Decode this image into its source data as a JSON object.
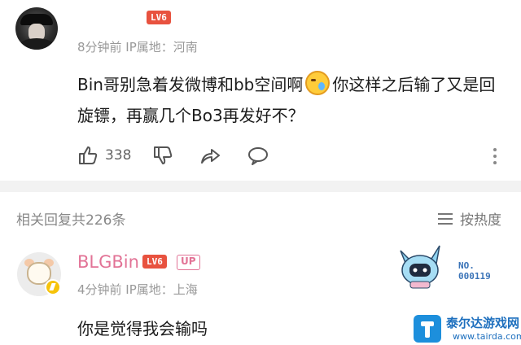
{
  "comment": {
    "level_badge": "LV6",
    "meta": "8分钟前 IP属地：河南",
    "text_part1": "Bin哥别急着发微博和bb空间啊",
    "text_part2": "你这样之后输了又是回旋镖，再赢几个Bo3再发好不？",
    "like_count": "338",
    "emoji_name": "crying-laughing-emoji"
  },
  "replies": {
    "header": "相关回复共226条",
    "sort_label": "按热度"
  },
  "reply": {
    "username": "BLGBin",
    "level_badge": "LV6",
    "up_badge": "UP",
    "meta": "4分钟前 IP属地：上海",
    "text": "你是觉得我会输吗",
    "decoration_label_line1": "NO.",
    "decoration_label_line2": "000119"
  },
  "watermark": {
    "title": "泰尔达游戏网",
    "url": "www.tairda.com"
  },
  "colors": {
    "level_badge": "#e8523f",
    "username_pink": "#e27396",
    "meta_gray": "#999999",
    "divider": "#f2f2f2",
    "vip_gold": "#f6c30a"
  },
  "icons": [
    "thumbs-up-icon",
    "thumbs-down-icon",
    "share-icon",
    "comment-icon",
    "more-vertical-icon",
    "sort-icon",
    "vip-icon"
  ]
}
